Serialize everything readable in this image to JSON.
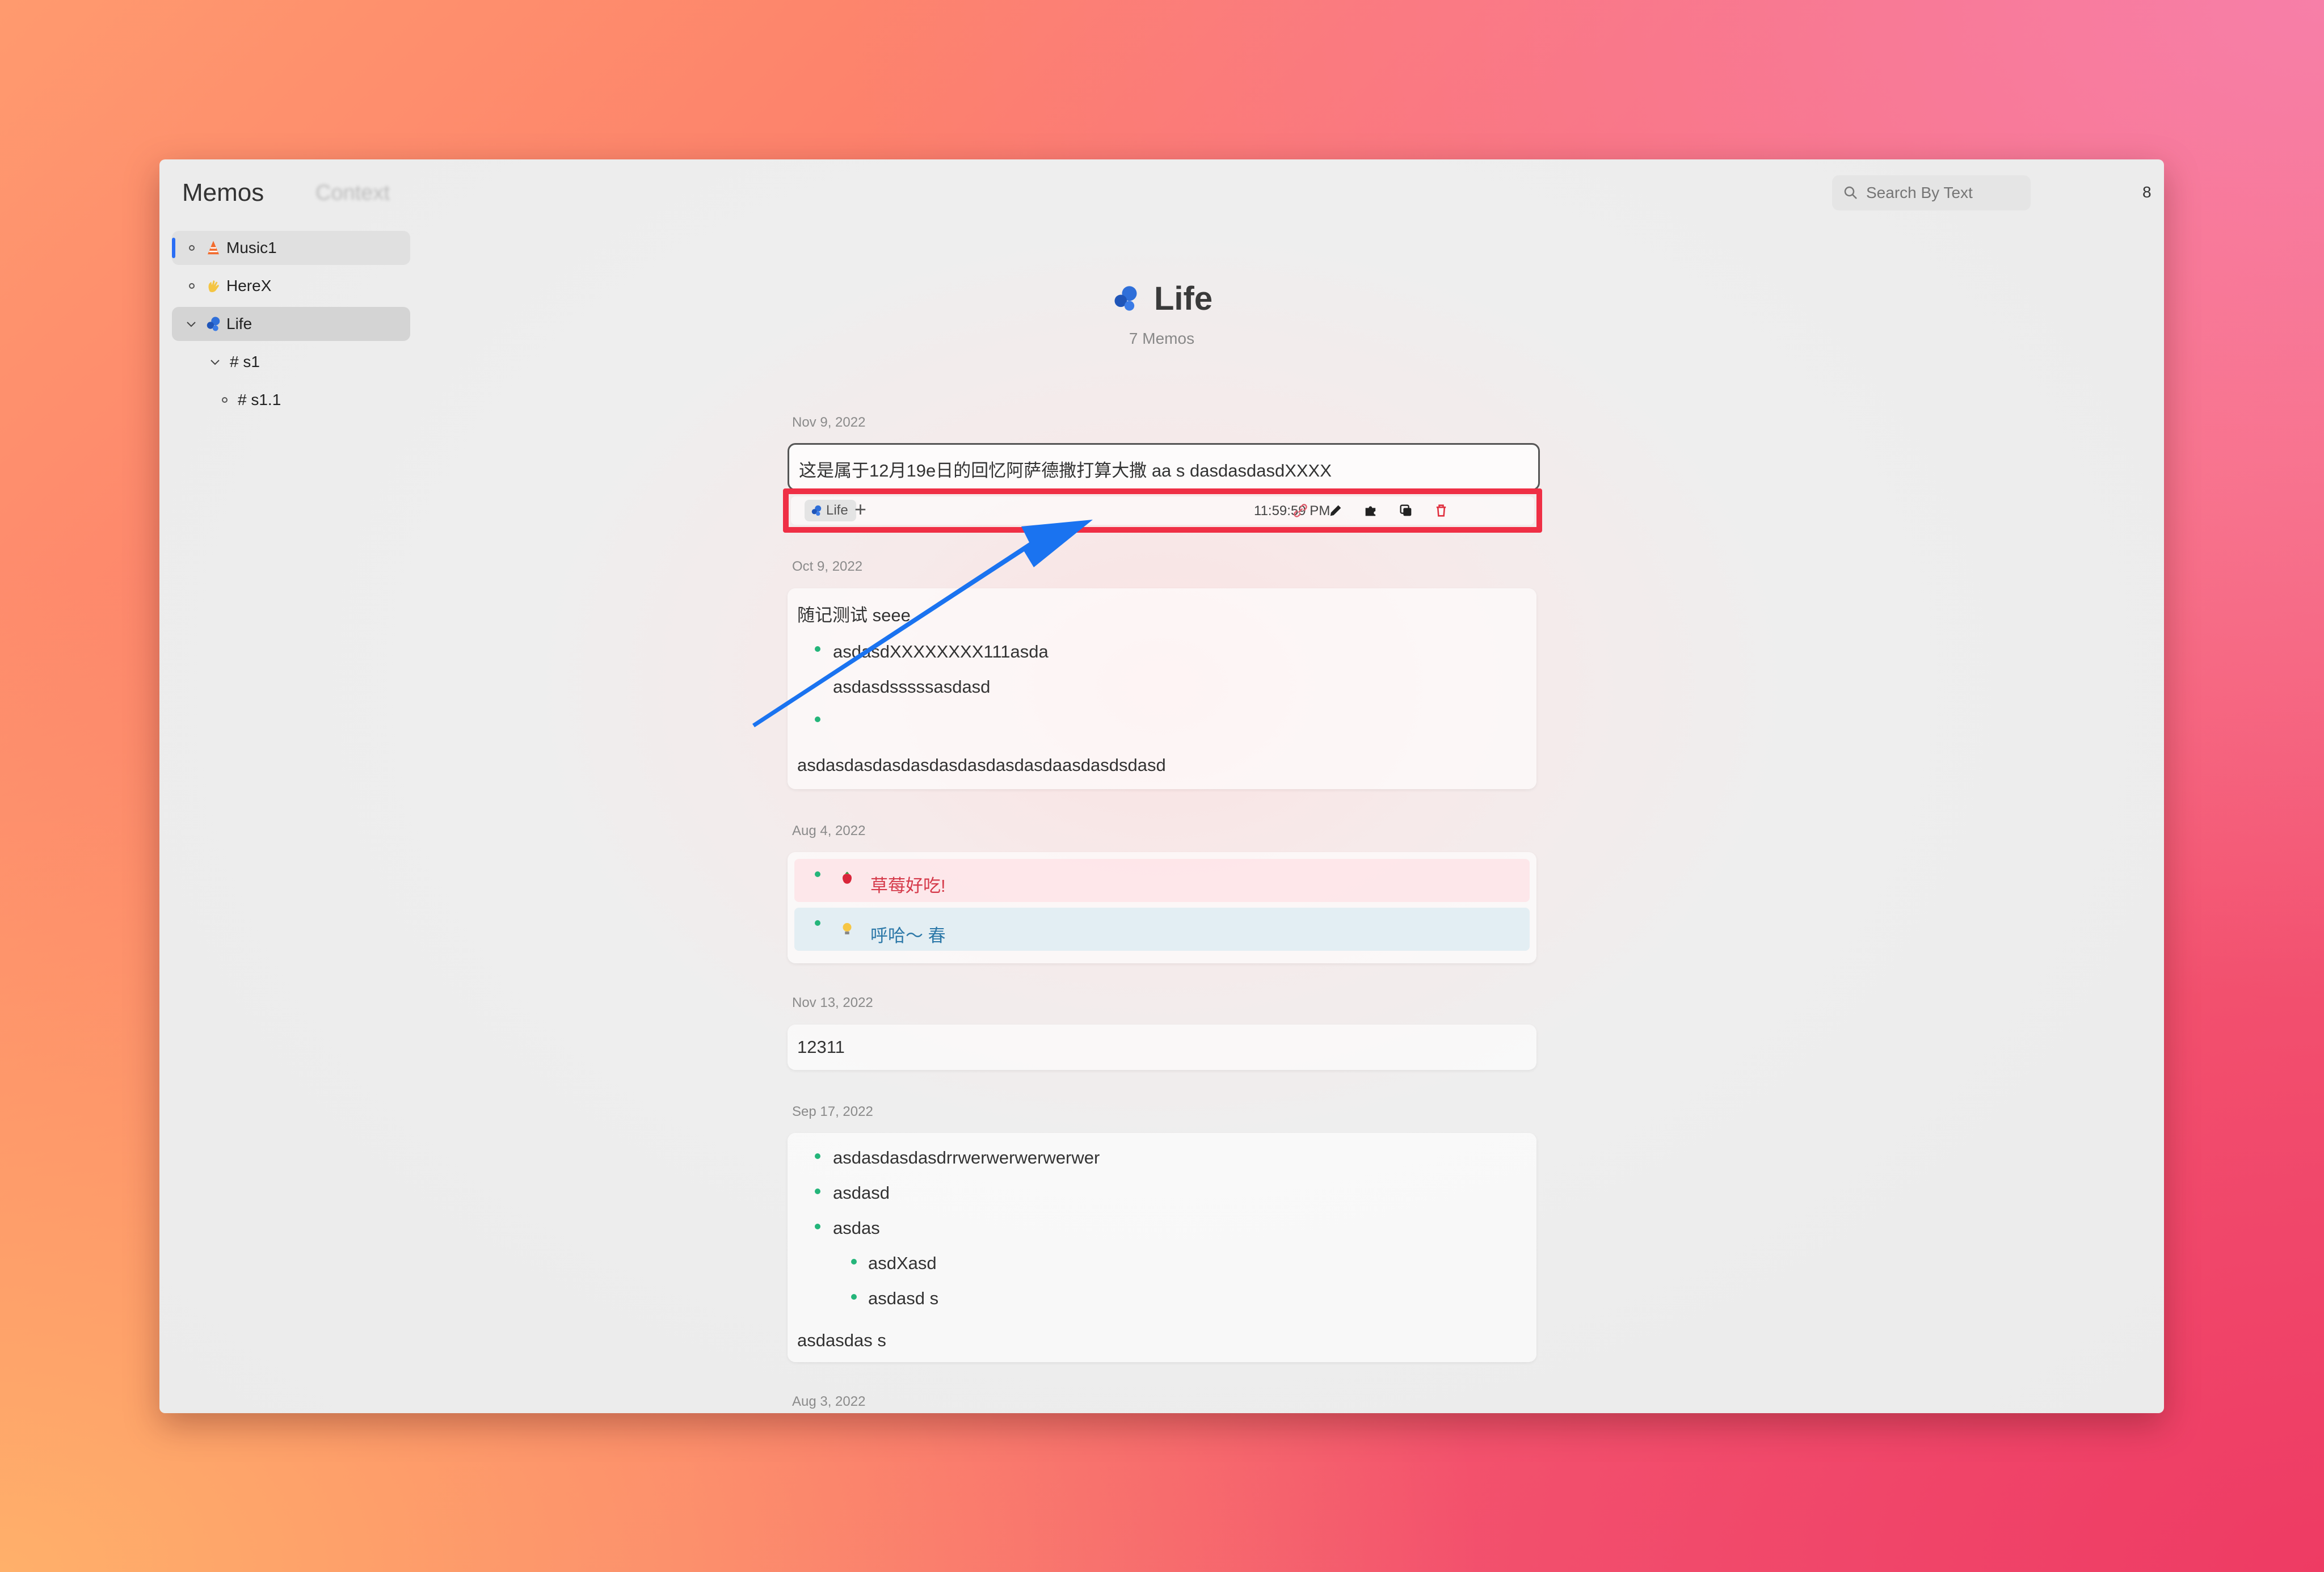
{
  "app": {
    "title": "Memos",
    "context_tab": "Context"
  },
  "search": {
    "placeholder": "Search By Text"
  },
  "header": {
    "memo_count": "8"
  },
  "sidebar": {
    "items": [
      {
        "label": "Music1"
      },
      {
        "label": "HereX"
      },
      {
        "label": "Life"
      },
      {
        "label": "# s1"
      },
      {
        "label": "# s1.1"
      }
    ]
  },
  "main": {
    "title": "Life",
    "subtitle": "7 Memos"
  },
  "memos": [
    {
      "date": "Nov 9, 2022",
      "text": "这是属于12月19e日的回忆阿萨德撒打算大撒 aa s dasdasdasdXXXX",
      "tag": "Life",
      "add": "+",
      "time": "11:59:59 PM"
    },
    {
      "date": "Oct 9, 2022",
      "title": "随记测试 seee",
      "items": [
        "asdasdXXXXXXXX111asda",
        "asdasdsssssasdasd",
        ""
      ],
      "footer": "asdasdasdasdasdasdasdasdasdaasdasdsdasd"
    },
    {
      "date": "Aug 4, 2022",
      "items": [
        "草莓好吃!",
        "呼哈～ 春"
      ]
    },
    {
      "date": "Nov 13, 2022",
      "text": "12311"
    },
    {
      "date": "Sep 17, 2022",
      "items": [
        "asdasdasdasdrrwerwerwerwerwer",
        "asdasd",
        "asdas"
      ],
      "subitems": [
        "asdXasd",
        "asdasd s"
      ],
      "footer": "asdasdas s"
    },
    {
      "date": "Aug 3, 2022"
    }
  ],
  "colors": {
    "accent_blue": "#2a6ef5",
    "highlight_red": "#ef2f45",
    "arrow_blue": "#1a73f0",
    "bullet_green": "#24b57a"
  }
}
